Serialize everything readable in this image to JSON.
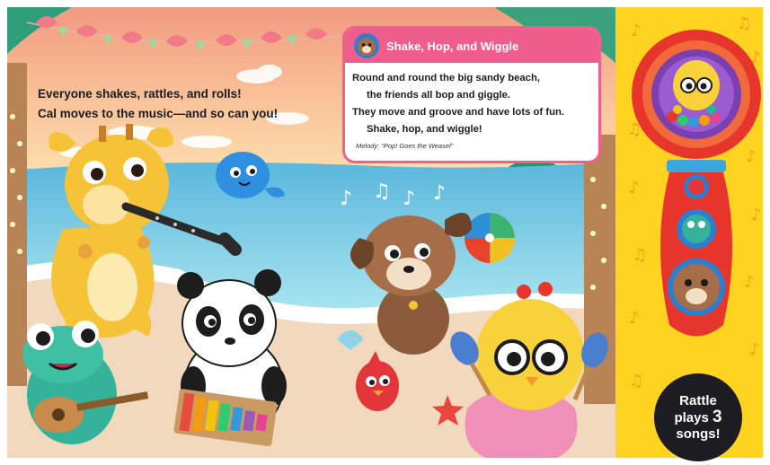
{
  "intro": {
    "line1": "Everyone shakes, rattles, and rolls!",
    "line2": "Cal moves to the music—and so can you!"
  },
  "song": {
    "title": "Shake, Hop, and Wiggle",
    "lines": [
      "Round and round the big sandy beach,",
      "the friends all bop and giggle.",
      "They move and groove and have lots of fun.",
      "Shake, hop, and wiggle!"
    ],
    "melody": "Melody: “Pop! Goes the Weasel”"
  },
  "badge": {
    "line1": "Rattle",
    "line2_prefix": "plays ",
    "line2_number": "3",
    "line3": "songs!"
  },
  "colors": {
    "sky_top": "#f6b48a",
    "sky_bottom": "#fbd8a8",
    "sea": "#7fd3ea",
    "sand": "#f3dcc0",
    "card_pink": "#ef5d8d",
    "side_panel_yellow": "#ffd31f",
    "rattle_red": "#e8352c",
    "badge_dark": "#1d1c22"
  }
}
